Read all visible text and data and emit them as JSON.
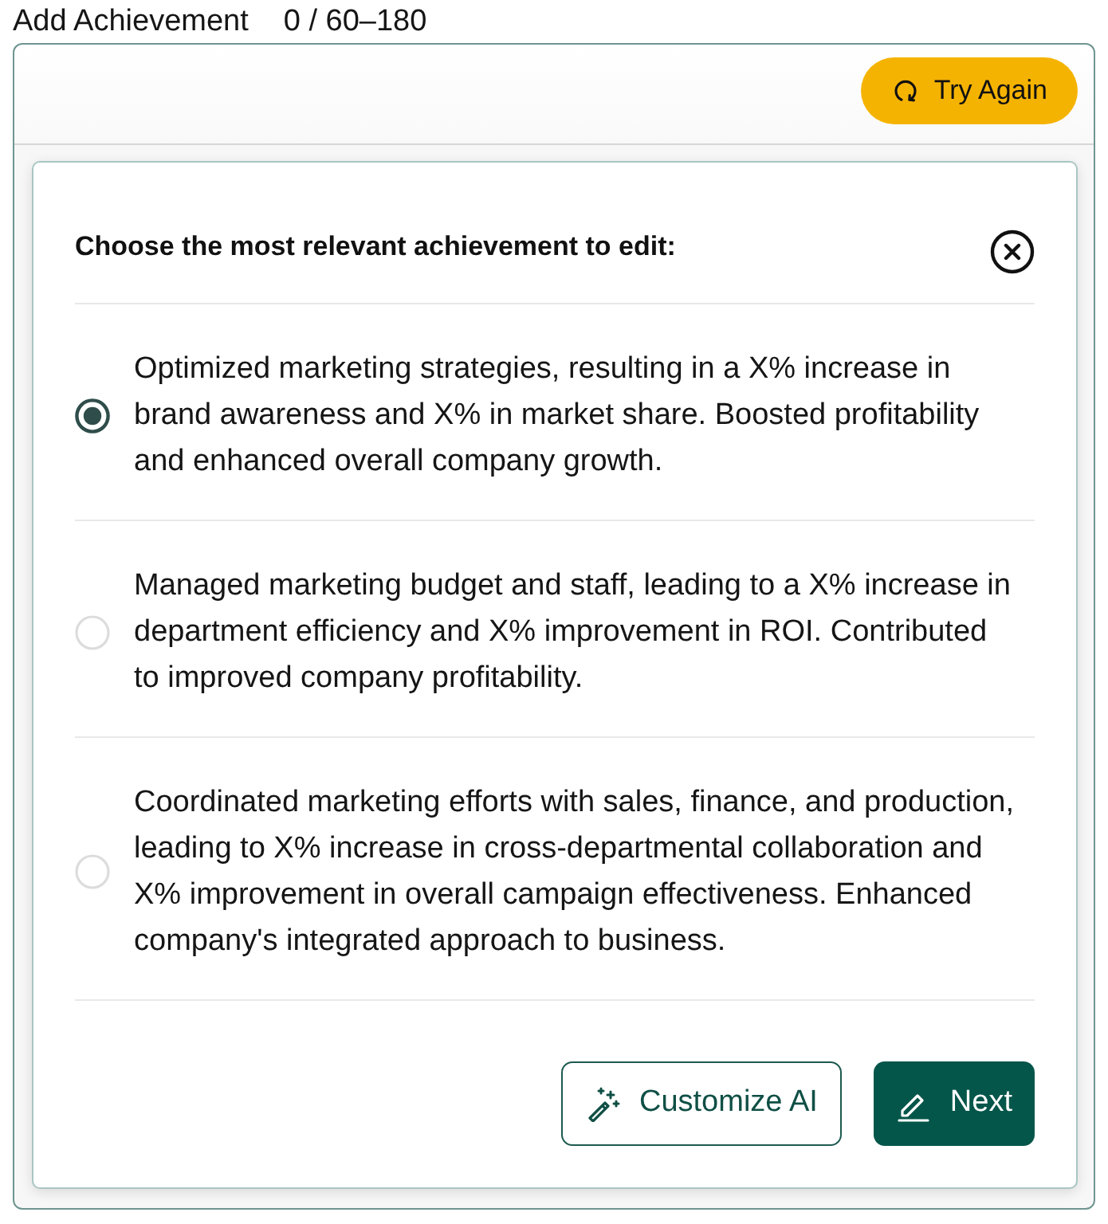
{
  "header": {
    "title": "Add Achievement",
    "counter": "0 / 60–180"
  },
  "toolbar": {
    "try_again": "Try Again"
  },
  "dialog": {
    "title": "Choose the most relevant achievement to edit:",
    "options": [
      {
        "text": "Optimized marketing strategies, resulting in a X% increase in brand awareness and X% in market share. Boosted profitability and enhanced overall company growth.",
        "selected": true
      },
      {
        "text": "Managed marketing budget and staff, leading to a X% increase in department efficiency and X% improvement in ROI. Contributed to improved company profitability.",
        "selected": false
      },
      {
        "text": "Coordinated marketing efforts with sales, finance, and production, leading to X% increase in cross-departmental collaboration and X% improvement in overall campaign effectiveness. Enhanced company's integrated approach to business.",
        "selected": false
      }
    ],
    "buttons": [
      {
        "label": "Customize AI",
        "kind": "outline"
      },
      {
        "label": "Next",
        "kind": "primary"
      }
    ]
  }
}
